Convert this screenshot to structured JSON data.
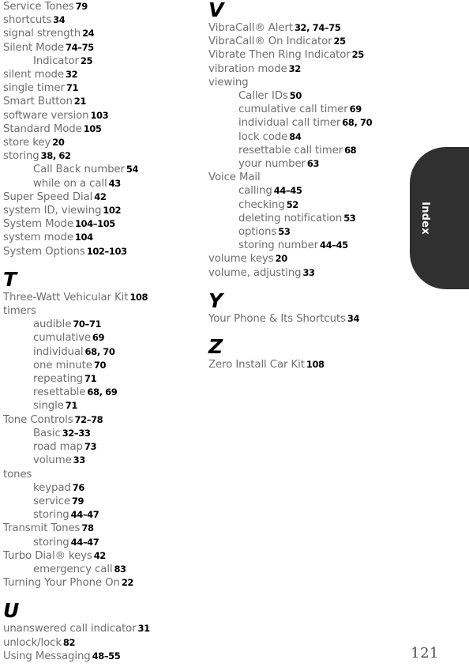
{
  "document": {
    "type": "index-page",
    "folio": "121",
    "thumb_tab_label": "Index",
    "colors": {
      "entry_text": "#6e6e6e",
      "page_number": "#000000",
      "tab_background": "#303030",
      "tab_text": "#ffffff"
    }
  },
  "columns": [
    {
      "name": "left",
      "blocks": [
        {
          "letter": "",
          "entries": [
            {
              "label": "Service Tones",
              "pages": "79",
              "indent": 0
            },
            {
              "label": "shortcuts",
              "pages": "34",
              "indent": 0
            },
            {
              "label": "signal strength",
              "pages": "24",
              "indent": 0
            },
            {
              "label": "Silent Mode",
              "pages": "74–75",
              "indent": 0
            },
            {
              "label": "Indicator",
              "pages": "25",
              "indent": 1
            },
            {
              "label": "silent mode",
              "pages": "32",
              "indent": 0
            },
            {
              "label": "single timer",
              "pages": "71",
              "indent": 0
            },
            {
              "label": "Smart Button",
              "pages": "21",
              "indent": 0
            },
            {
              "label": "software version",
              "pages": "103",
              "indent": 0
            },
            {
              "label": "Standard Mode",
              "pages": "105",
              "indent": 0
            },
            {
              "label": "store key",
              "pages": "20",
              "indent": 0
            },
            {
              "label": "storing",
              "pages": "38, 62",
              "indent": 0
            },
            {
              "label": "Call Back number",
              "pages": "54",
              "indent": 1
            },
            {
              "label": "while on a call",
              "pages": "43",
              "indent": 1
            },
            {
              "label": "Super Speed Dial",
              "pages": "42",
              "indent": 0
            },
            {
              "label": "system ID, viewing",
              "pages": "102",
              "indent": 0
            },
            {
              "label": "System Mode",
              "pages": "104–105",
              "indent": 0
            },
            {
              "label": "system mode",
              "pages": "104",
              "indent": 0
            },
            {
              "label": "System Options",
              "pages": "102–103",
              "indent": 0
            }
          ]
        },
        {
          "letter": "T",
          "entries": [
            {
              "label": "Three-Watt Vehicular Kit",
              "pages": "108",
              "indent": 0
            },
            {
              "label": "timers",
              "pages": "",
              "indent": 0
            },
            {
              "label": "audible",
              "pages": "70–71",
              "indent": 1
            },
            {
              "label": "cumulative",
              "pages": "69",
              "indent": 1
            },
            {
              "label": "individual",
              "pages": "68, 70",
              "indent": 1
            },
            {
              "label": "one minute",
              "pages": "70",
              "indent": 1
            },
            {
              "label": "repeating",
              "pages": "71",
              "indent": 1
            },
            {
              "label": "resettable",
              "pages": "68, 69",
              "indent": 1
            },
            {
              "label": "single",
              "pages": "71",
              "indent": 1
            },
            {
              "label": "Tone Controls",
              "pages": "72–78",
              "indent": 0
            },
            {
              "label": "Basic",
              "pages": "32–33",
              "indent": 1
            },
            {
              "label": "road map",
              "pages": "73",
              "indent": 1
            },
            {
              "label": "volume",
              "pages": "33",
              "indent": 1
            },
            {
              "label": "tones",
              "pages": "",
              "indent": 0
            },
            {
              "label": "keypad",
              "pages": "76",
              "indent": 1
            },
            {
              "label": "service",
              "pages": "79",
              "indent": 1
            },
            {
              "label": "storing",
              "pages": "44–47",
              "indent": 1
            },
            {
              "label": "Transmit Tones",
              "pages": "78",
              "indent": 0
            },
            {
              "label": "storing",
              "pages": "44–47",
              "indent": 1
            },
            {
              "label": "Turbo Dial® keys",
              "pages": "42",
              "indent": 0
            },
            {
              "label": "emergency call",
              "pages": "83",
              "indent": 1
            },
            {
              "label": "Turning Your Phone On",
              "pages": "22",
              "indent": 0
            }
          ]
        },
        {
          "letter": "U",
          "entries": [
            {
              "label": "unanswered call indicator",
              "pages": "31",
              "indent": 0
            },
            {
              "label": "unlock/lock",
              "pages": "82",
              "indent": 0
            },
            {
              "label": "Using Messaging",
              "pages": "48–55",
              "indent": 0
            }
          ]
        }
      ]
    },
    {
      "name": "right",
      "blocks": [
        {
          "letter": "V",
          "entries": [
            {
              "label": "VibraCall® Alert",
              "pages": "32, 74–75",
              "indent": 0
            },
            {
              "label": "VibraCall® On Indicator",
              "pages": "25",
              "indent": 0
            },
            {
              "label": "Vibrate Then Ring Indicator",
              "pages": "25",
              "indent": 0
            },
            {
              "label": "vibration mode",
              "pages": "32",
              "indent": 0
            },
            {
              "label": "viewing",
              "pages": "",
              "indent": 0
            },
            {
              "label": "Caller IDs",
              "pages": "50",
              "indent": 1
            },
            {
              "label": "cumulative call timer",
              "pages": "69",
              "indent": 1
            },
            {
              "label": "individual call timer",
              "pages": "68, 70",
              "indent": 1
            },
            {
              "label": "lock code",
              "pages": "84",
              "indent": 1
            },
            {
              "label": "resettable call timer",
              "pages": "68",
              "indent": 1
            },
            {
              "label": "your number",
              "pages": "63",
              "indent": 1
            },
            {
              "label": "Voice Mail",
              "pages": "",
              "indent": 0
            },
            {
              "label": "calling",
              "pages": "44–45",
              "indent": 1
            },
            {
              "label": "checking",
              "pages": "52",
              "indent": 1
            },
            {
              "label": "deleting notification",
              "pages": "53",
              "indent": 1
            },
            {
              "label": "options",
              "pages": "53",
              "indent": 1
            },
            {
              "label": "storing number",
              "pages": "44–45",
              "indent": 1
            },
            {
              "label": "volume keys",
              "pages": "20",
              "indent": 0
            },
            {
              "label": "volume, adjusting",
              "pages": "33",
              "indent": 0
            }
          ]
        },
        {
          "letter": "Y",
          "entries": [
            {
              "label": "Your Phone & Its Shortcuts",
              "pages": "34",
              "indent": 0
            }
          ]
        },
        {
          "letter": "Z",
          "entries": [
            {
              "label": "Zero Install Car Kit",
              "pages": "108",
              "indent": 0
            }
          ]
        }
      ]
    }
  ]
}
